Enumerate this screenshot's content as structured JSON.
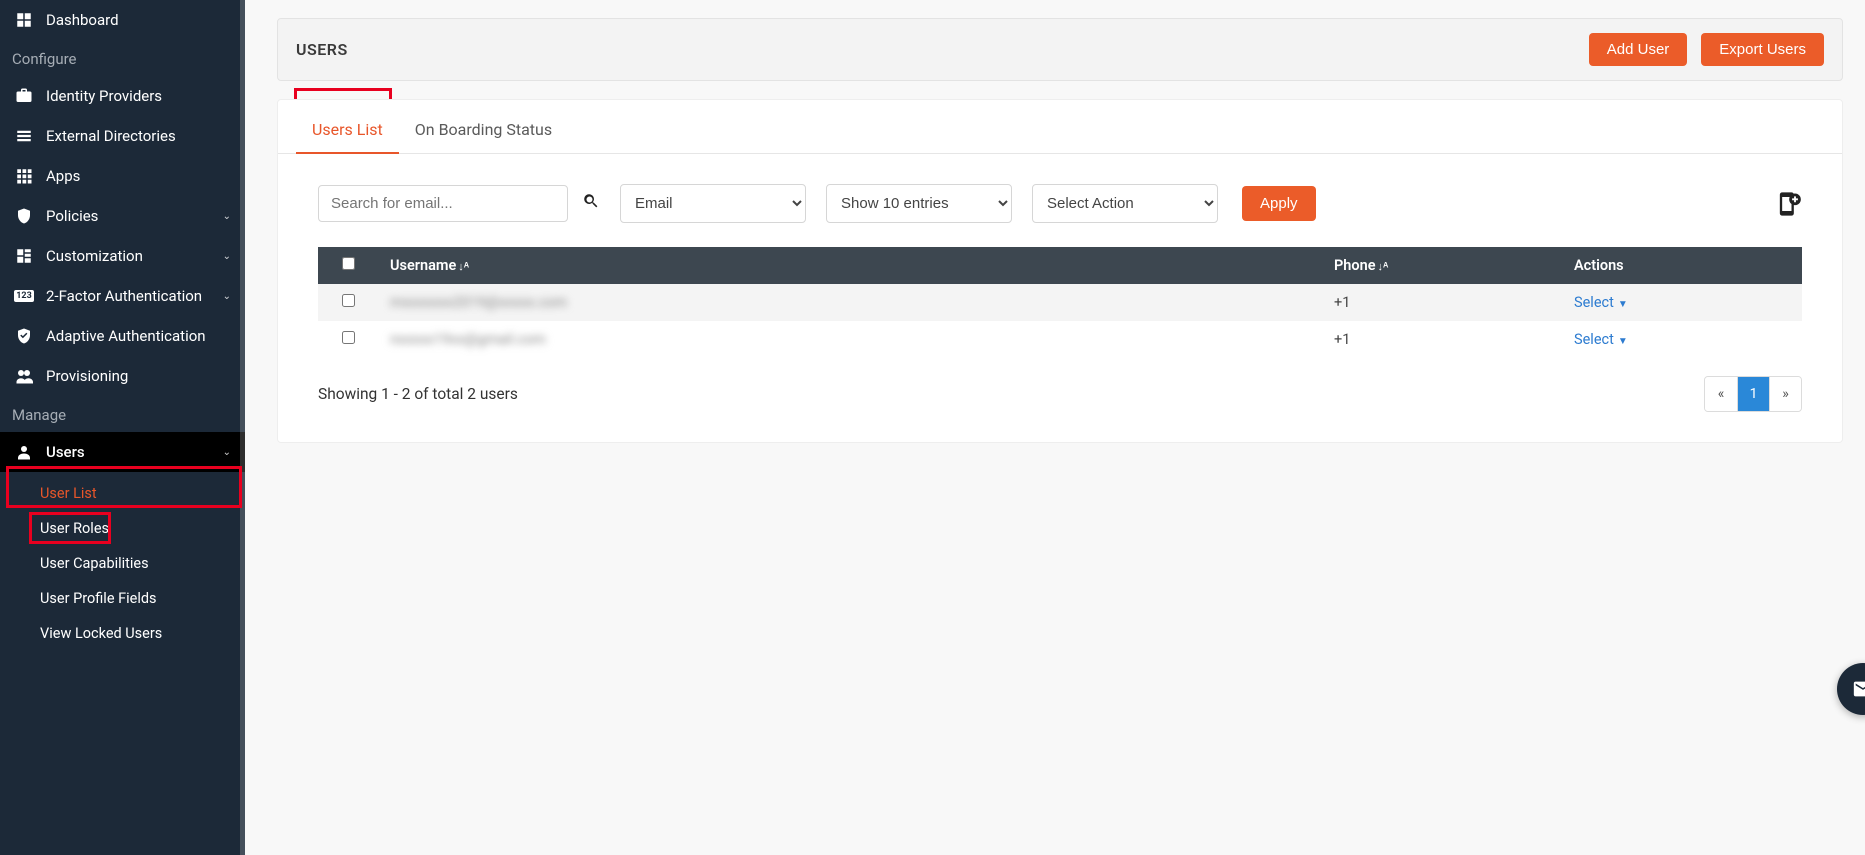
{
  "sidebar": {
    "dashboard": "Dashboard",
    "section_configure": "Configure",
    "identity_providers": "Identity Providers",
    "external_directories": "External Directories",
    "apps": "Apps",
    "policies": "Policies",
    "customization": "Customization",
    "two_factor": "2-Factor Authentication",
    "adaptive_auth": "Adaptive Authentication",
    "provisioning": "Provisioning",
    "section_manage": "Manage",
    "users": "Users",
    "sub": {
      "user_list": "User List",
      "user_roles": "User Roles",
      "user_capabilities": "User Capabilities",
      "user_profile_fields": "User Profile Fields",
      "view_locked_users": "View Locked Users"
    }
  },
  "header": {
    "title": "USERS",
    "add_user": "Add User",
    "export_users": "Export Users"
  },
  "tabs": {
    "users_list": "Users List",
    "onboarding": "On Boarding Status"
  },
  "toolbar": {
    "search_placeholder": "Search for email...",
    "filter_field": "Email",
    "page_size": "Show 10 entries",
    "select_action": "Select Action",
    "apply": "Apply"
  },
  "table": {
    "col_username": "Username",
    "col_phone": "Phone",
    "col_actions": "Actions",
    "rows": [
      {
        "username": "mxxxxxxx2019@xxxxx.com",
        "phone": "+1",
        "action_label": "Select"
      },
      {
        "username": "nxxxxx19xx@gmail.com",
        "phone": "+1",
        "action_label": "Select"
      }
    ]
  },
  "footer": {
    "summary": "Showing 1 - 2 of total 2 users",
    "prev": "«",
    "page": "1",
    "next": "»"
  }
}
